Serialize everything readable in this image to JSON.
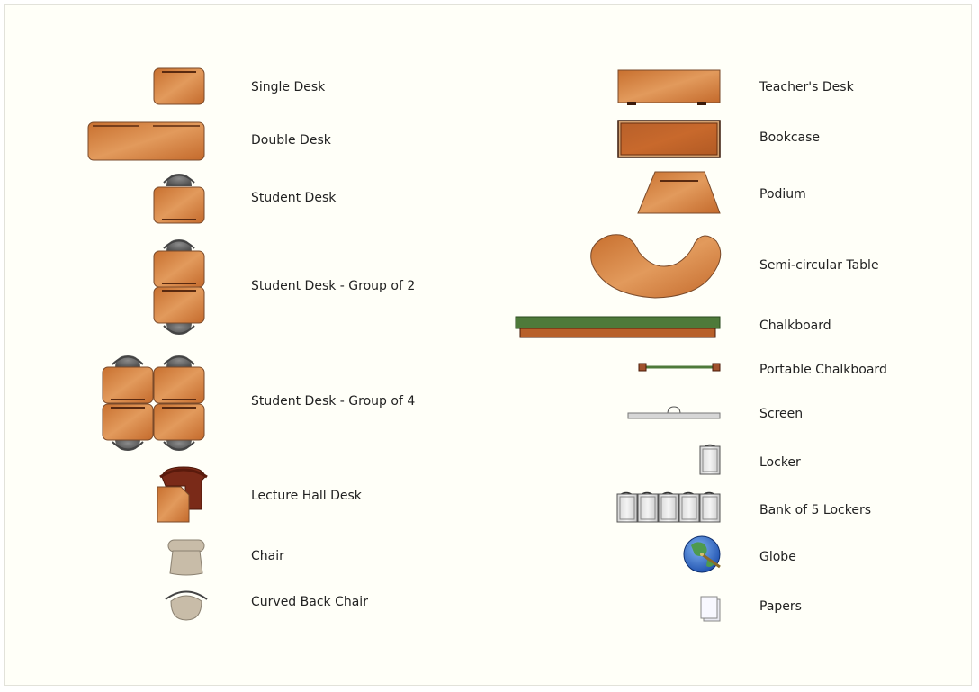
{
  "colors": {
    "desk_wood": "#d2783c",
    "desk_wood_light": "#e39a5e",
    "desk_line": "#5a2a10",
    "chair_gray": "#6a6a6a",
    "chair_beige": "#c8bca8",
    "lecture_dark": "#7a2a18",
    "board_green": "#4e7a3a",
    "label_text": "#222222"
  },
  "left_items": [
    {
      "label": "Single Desk",
      "icon": "single-desk-icon"
    },
    {
      "label": "Double Desk",
      "icon": "double-desk-icon"
    },
    {
      "label": "Student Desk",
      "icon": "student-desk-icon"
    },
    {
      "label": "Student Desk - Group of 2",
      "icon": "student-desk-group-2-icon"
    },
    {
      "label": "Student Desk - Group of 4",
      "icon": "student-desk-group-4-icon"
    },
    {
      "label": "Lecture Hall Desk",
      "icon": "lecture-hall-desk-icon"
    },
    {
      "label": "Chair",
      "icon": "chair-icon"
    },
    {
      "label": "Curved Back Chair",
      "icon": "curved-back-chair-icon"
    }
  ],
  "right_items": [
    {
      "label": "Teacher's Desk",
      "icon": "teachers-desk-icon"
    },
    {
      "label": "Bookcase",
      "icon": "bookcase-icon"
    },
    {
      "label": "Podium",
      "icon": "podium-icon"
    },
    {
      "label": "Semi-circular Table",
      "icon": "semi-circular-table-icon"
    },
    {
      "label": "Chalkboard",
      "icon": "chalkboard-icon"
    },
    {
      "label": "Portable Chalkboard",
      "icon": "portable-chalkboard-icon"
    },
    {
      "label": "Screen",
      "icon": "screen-icon"
    },
    {
      "label": "Locker",
      "icon": "locker-icon"
    },
    {
      "label": "Bank of 5 Lockers",
      "icon": "bank-of-5-lockers-icon"
    },
    {
      "label": "Globe",
      "icon": "globe-icon"
    },
    {
      "label": "Papers",
      "icon": "papers-icon"
    }
  ]
}
